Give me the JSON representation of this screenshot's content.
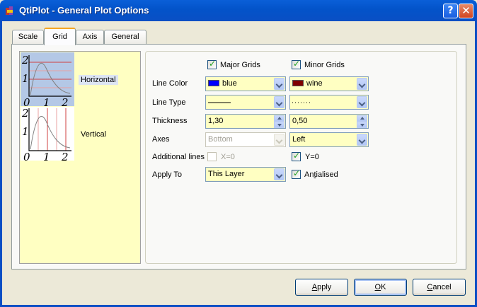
{
  "window": {
    "title": "QtiPlot - General Plot Options",
    "help_glyph": "?",
    "close_glyph": "✕"
  },
  "tabs": [
    {
      "label": "Scale",
      "active": false
    },
    {
      "label": "Grid",
      "active": true
    },
    {
      "label": "Axis",
      "active": false
    },
    {
      "label": "General",
      "active": false
    }
  ],
  "preview_list": [
    {
      "label": "Horizontal",
      "selected": true,
      "ticks_y": [
        "2",
        "1"
      ],
      "ticks_x": [
        "0",
        "1",
        "2"
      ]
    },
    {
      "label": "Vertical",
      "selected": false,
      "ticks_y": [
        "2",
        "1"
      ],
      "ticks_x": [
        "0",
        "1",
        "2"
      ]
    }
  ],
  "grid": {
    "major_label": "Major Grids",
    "major_checked": true,
    "minor_label": "Minor Grids",
    "minor_checked": true,
    "line_color": {
      "label": "Line Color",
      "major": "blue",
      "major_hex": "#0000ff",
      "minor": "wine",
      "minor_hex": "#800000"
    },
    "line_type": {
      "label": "Line Type",
      "major": "solid",
      "minor": "dotted"
    },
    "thickness": {
      "label": "Thickness",
      "major": "1,30",
      "minor": "0,50"
    },
    "axes": {
      "label": "Axes",
      "major": "Bottom",
      "minor": "Left"
    },
    "additional": {
      "label": "Additional lines",
      "x0": "X=0",
      "x0_checked": false,
      "y0": "Y=0",
      "y0_checked": true
    },
    "apply_to": {
      "label": "Apply To",
      "value": "This Layer"
    },
    "antialiased": {
      "label_pre": "An",
      "label_ul": "t",
      "label_post": "ialised",
      "checked": true
    }
  },
  "buttons": {
    "apply": {
      "ul": "A",
      "rest": "pply"
    },
    "ok": {
      "ul": "O",
      "rest": "K"
    },
    "cancel": {
      "ul": "C",
      "rest": "ancel"
    }
  },
  "colors": {
    "accent": "#0a4fc4",
    "panel_bg": "#ffffc2",
    "selection": "#b4c8e6"
  }
}
